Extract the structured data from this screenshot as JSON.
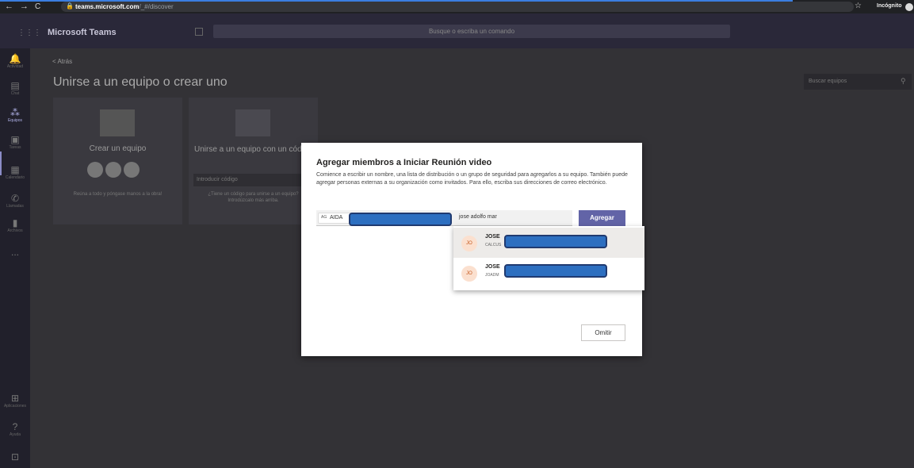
{
  "browser": {
    "url_host": "teams.microsoft.com",
    "url_path": "/_#/discover",
    "incognito_label": "Incógnito"
  },
  "header": {
    "app_name": "Microsoft Teams",
    "search_placeholder": "Busque o escriba un comando"
  },
  "rail": {
    "items": [
      {
        "label": "Actividad",
        "icon": "bell-icon"
      },
      {
        "label": "Chat",
        "icon": "chat-icon"
      },
      {
        "label": "Equipos",
        "icon": "teams-icon"
      },
      {
        "label": "Tareas",
        "icon": "tasks-icon"
      },
      {
        "label": "Calendario",
        "icon": "calendar-icon"
      },
      {
        "label": "Llamadas",
        "icon": "phone-icon"
      },
      {
        "label": "Archivos",
        "icon": "files-icon"
      },
      {
        "label": "...",
        "icon": "more-icon"
      }
    ],
    "bottom": [
      {
        "label": "Aplicaciones",
        "icon": "apps-icon"
      },
      {
        "label": "Ayuda",
        "icon": "help-icon"
      }
    ]
  },
  "page": {
    "back": "< Atrás",
    "title": "Unirse a un equipo o crear uno",
    "team_search_placeholder": "Buscar equipos"
  },
  "cards": {
    "create": {
      "title": "Crear un equipo",
      "desc": "Reúna a todo y póngase manos a la obra!"
    },
    "join": {
      "title": "Unirse a un equipo con un código",
      "code_placeholder": "Introducir código",
      "desc": "¿Tiene un código para unirse a un equipo? Introdúzcalo más arriba."
    }
  },
  "dialog": {
    "title": "Agregar miembros a Iniciar Reunión video",
    "description": "Comience a escribir un nombre, una lista de distribución o un grupo de seguridad para agregarlos a su equipo. También puede agregar personas externas a su organización como invitados. Para ello, escriba sus direcciones de correo electrónico.",
    "pill_initials": "AG",
    "pill_name": "AIDA",
    "typed_text": "jose adolfo mar",
    "add_label": "Agregar",
    "skip_label": "Omitir",
    "suggestions": [
      {
        "initials": "JO",
        "name": "JOSE",
        "sub": "CALCUS"
      },
      {
        "initials": "JO",
        "name": "JOSE",
        "sub": "JOADM"
      }
    ]
  },
  "colors": {
    "accent": "#6264a7",
    "redaction": "#2d6fc0"
  }
}
